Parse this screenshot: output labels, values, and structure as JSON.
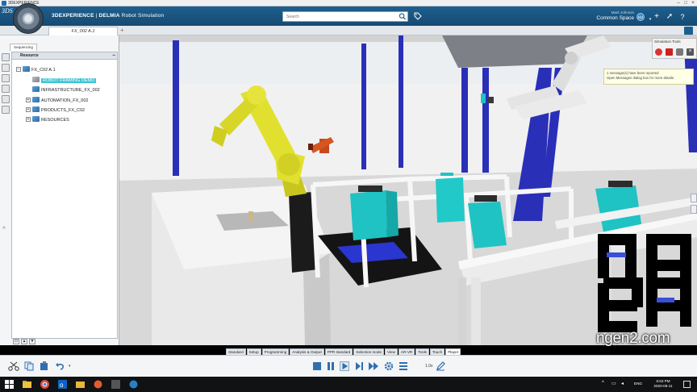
{
  "window": {
    "title": "3DEXPERIENCE"
  },
  "header": {
    "brand_left": "3DEXPERIENCE",
    "brand_sep": " | ",
    "brand_app": "DELMIA",
    "brand_module": "Robot Simulation",
    "search_placeholder": "Search",
    "user_name": "Mark Johnson",
    "space": "Common Space",
    "avatar_initials": "MJ",
    "compass_logo": "3DS"
  },
  "tabs": {
    "active_label": "FX_002 A.1",
    "add_label": "+"
  },
  "left_panel": {
    "tab_label": "Sequencing",
    "tree_header": "Resource",
    "tree": [
      {
        "label": "FX_C02 A.1",
        "icon": "product-cube-icon"
      },
      {
        "label": "ROBOT FRAMING DEMO",
        "icon": "folder-icon"
      },
      {
        "label": "INFRASTRUCTURE_FX_002",
        "icon": "product-cube-icon"
      },
      {
        "label": "AUTOMATION_FX_002",
        "icon": "product-cube-icon"
      },
      {
        "label": "PRODUCTS_FX_C02",
        "icon": "product-cube-icon"
      },
      {
        "label": "RESOURCES",
        "icon": "product-cube-icon"
      }
    ]
  },
  "sim_tools": {
    "label": "Simulation Tools",
    "icons": [
      "record-icon",
      "stop-icon",
      "camera-icon",
      "close-icon"
    ]
  },
  "tooltip": {
    "line1": "1 message(s) have been reported",
    "line2": "Open Messages dialog box for more details."
  },
  "logo": {
    "url": "ngen2.com"
  },
  "action_tabs": [
    "Standard",
    "Setup",
    "Programming",
    "Analysis & Output",
    "PPR standard",
    "Selection mode",
    "View",
    "AR-VR",
    "Tools",
    "Touch",
    "Player"
  ],
  "active_action_tab": "Player",
  "player": {
    "speed": "1.0x"
  },
  "taskbar": {
    "lang": "ENG",
    "time": "5:53 PM",
    "date": "2020-06-11"
  },
  "colors": {
    "header": "#1f5f8f",
    "pillar": "#2a2fb8",
    "robot_yellow": "#e1e02e",
    "cyan_fixture": "#1fc3c3",
    "highlight": "#3bc4d4"
  }
}
